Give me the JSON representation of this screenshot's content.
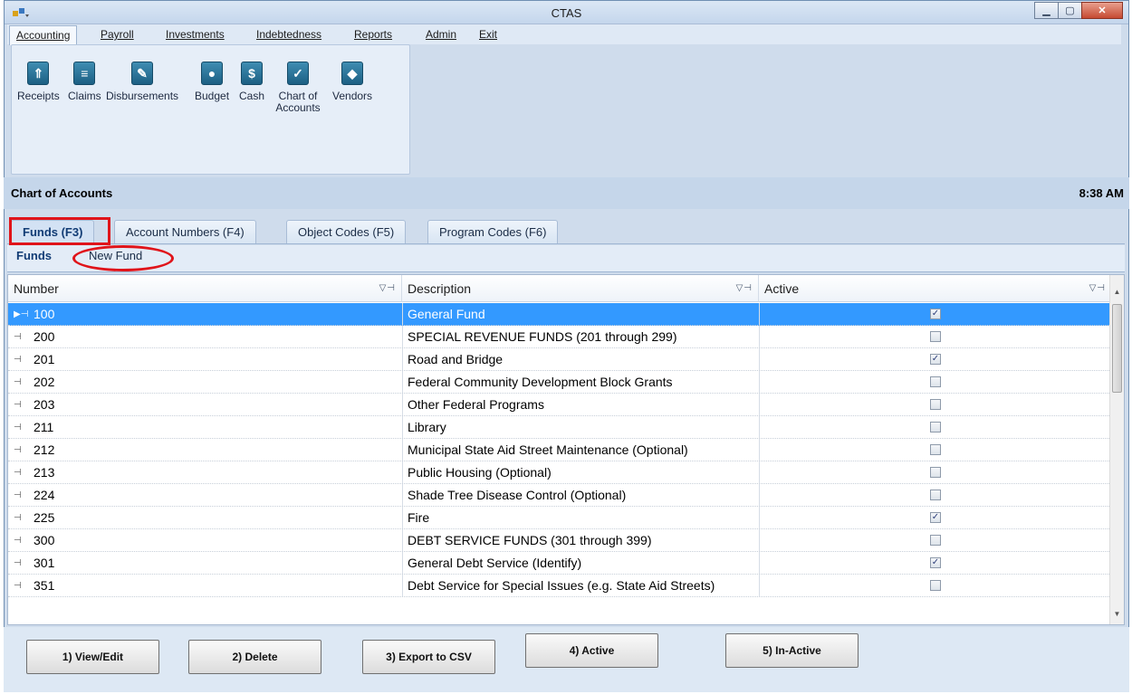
{
  "window": {
    "title": "CTAS"
  },
  "menu": [
    "Accounting",
    "Payroll",
    "Investments",
    "Indebtedness",
    "Reports",
    "Admin",
    "Exit"
  ],
  "ribbon": [
    {
      "label": "Receipts",
      "icon": "receipt-icon"
    },
    {
      "label": "Claims",
      "icon": "claims-icon"
    },
    {
      "label": "Disbursements",
      "icon": "disbursements-icon"
    },
    {
      "label": "Budget",
      "icon": "budget-icon"
    },
    {
      "label": "Cash",
      "icon": "cash-icon"
    },
    {
      "label": "Chart of Accounts",
      "icon": "chart-of-accounts-icon"
    },
    {
      "label": "Vendors",
      "icon": "vendors-icon"
    }
  ],
  "section": {
    "title": "Chart of Accounts",
    "time": "8:38 AM"
  },
  "tabs": [
    "Funds (F3)",
    "Account Numbers (F4)",
    "Object Codes (F5)",
    "Program Codes (F6)"
  ],
  "subtabs": [
    "Funds",
    "New Fund"
  ],
  "grid": {
    "headers": [
      "Number",
      "Description",
      "Active"
    ],
    "rows": [
      {
        "number": "100",
        "description": "General Fund",
        "active": true
      },
      {
        "number": "200",
        "description": "SPECIAL REVENUE FUNDS (201 through 299)",
        "active": false
      },
      {
        "number": "201",
        "description": "Road and Bridge",
        "active": true
      },
      {
        "number": "202",
        "description": "Federal Community Development Block Grants",
        "active": false
      },
      {
        "number": "203",
        "description": "Other Federal Programs",
        "active": false
      },
      {
        "number": "211",
        "description": "Library",
        "active": false
      },
      {
        "number": "212",
        "description": "Municipal State Aid Street Maintenance (Optional)",
        "active": false
      },
      {
        "number": "213",
        "description": "Public Housing (Optional)",
        "active": false
      },
      {
        "number": "224",
        "description": "Shade Tree Disease Control (Optional)",
        "active": false
      },
      {
        "number": "225",
        "description": "Fire",
        "active": true
      },
      {
        "number": "300",
        "description": "DEBT SERVICE FUNDS (301 through 399)",
        "active": false
      },
      {
        "number": "301",
        "description": "General Debt Service (Identify)",
        "active": true
      },
      {
        "number": "351",
        "description": "Debt Service for Special Issues (e.g. State Aid Streets)",
        "active": false
      }
    ]
  },
  "buttons": [
    "1) View/Edit",
    "2) Delete",
    "3) Export to CSV",
    "4) Active",
    "5) In-Active"
  ]
}
